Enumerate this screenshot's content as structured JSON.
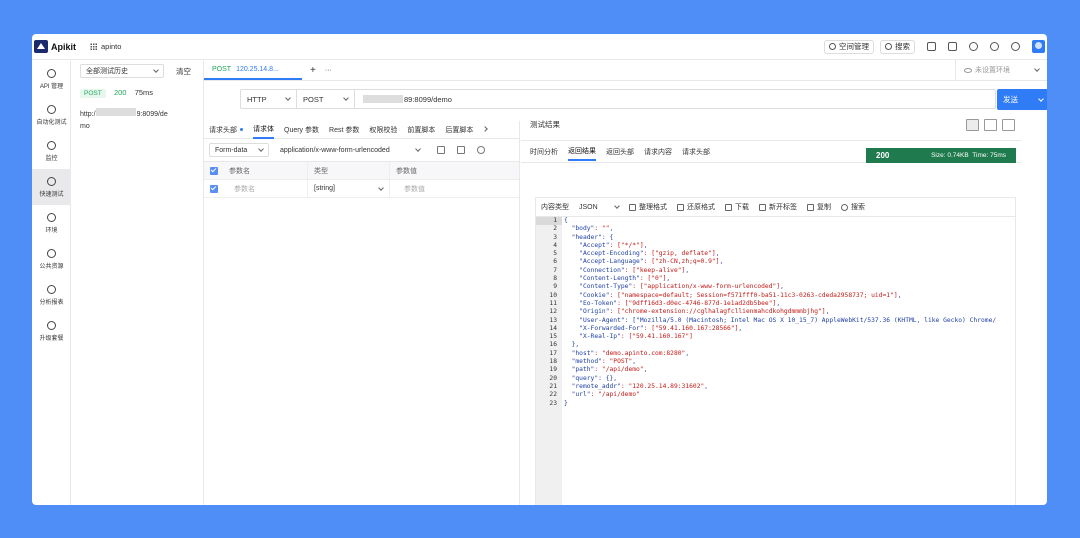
{
  "app": {
    "name": "Apikit",
    "workspace": "apinto"
  },
  "top_actions": {
    "space_manage": "空间管理",
    "search": "搜索"
  },
  "nav": [
    {
      "label": "API 管理",
      "icon": "api-icon"
    },
    {
      "label": "自动化测试",
      "icon": "robot-icon"
    },
    {
      "label": "监控",
      "icon": "monitor-icon"
    },
    {
      "label": "快速测试",
      "icon": "rocket-icon",
      "active": true
    },
    {
      "label": "环境",
      "icon": "environment-icon"
    },
    {
      "label": "公共资源",
      "icon": "share-icon"
    },
    {
      "label": "分析报表",
      "icon": "chart-icon"
    },
    {
      "label": "升级套餐",
      "icon": "upgrade-icon"
    }
  ],
  "history": {
    "filter": "全部测试历史",
    "clear": "清空",
    "item": {
      "method": "POST",
      "status": "200",
      "time": "75ms",
      "url_prefix": "http:/",
      "url_suffix": "9:8099/de",
      "url_line2": "mo"
    }
  },
  "tab": {
    "method": "POST",
    "url": "120.25.14.8...",
    "add": "+",
    "more": "···",
    "env": "未设置环境"
  },
  "request": {
    "protocol": "HTTP",
    "method": "POST",
    "url_suffix": "89:8099/demo",
    "send": "发送"
  },
  "req_tabs": [
    "请求头部",
    "请求体",
    "Query 参数",
    "Rest 参数",
    "权限校验",
    "前置脚本",
    "后置脚本"
  ],
  "body": {
    "mode": "Form-data",
    "content_type": "application/x-www-form-urlencoded"
  },
  "params": {
    "head": {
      "name": "参数名",
      "type": "类型",
      "value": "参数值"
    },
    "row": {
      "name": "参数名",
      "type": "[string]",
      "value": "参数值"
    }
  },
  "result": {
    "title": "测试结果",
    "tabs": [
      "时间分析",
      "返回结果",
      "返回头部",
      "请求内容",
      "请求头部"
    ],
    "status_code": "200",
    "size": "Size: 0.74KB",
    "time": "Time: 75ms",
    "content_type_label": "内容类型",
    "format": "JSON",
    "actions": [
      "整理格式",
      "还原格式",
      "下载",
      "新开标签",
      "复制",
      "搜索"
    ]
  },
  "code_lines": [
    "{",
    "  \"body\": \"\",",
    "  \"header\": {",
    "    \"Accept\": [\"*/*\"],",
    "    \"Accept-Encoding\": [\"gzip, deflate\"],",
    "    \"Accept-Language\": [\"zh-CN,zh;q=0.9\"],",
    "    \"Connection\": [\"keep-alive\"],",
    "    \"Content-Length\": [\"0\"],",
    "    \"Content-Type\": [\"application/x-www-form-urlencoded\"],",
    "    \"Cookie\": [\"namespace=default; Session=f571fff0-ba51-11c3-0263-cdeda2958737; uid=1\"],",
    "    \"Eo-Token\": [\"9dff16d3-d0ec-4746-877d-1e1ad2db5bee\"],",
    "    \"Origin\": [\"chrome-extension://cglhalagfcllienmahcdkohgdmmmbjhg\"],",
    "    \"User-Agent\": [\"Mozilla/5.0 (Macintosh; Intel Mac OS X 10_15_7) AppleWebKit/537.36 (KHTML, like Gecko) Chrome/",
    "    \"X-Forwarded-For\": [\"59.41.160.167:28566\"],",
    "    \"X-Real-Ip\": [\"59.41.160.167\"]",
    "  },",
    "  \"host\": \"demo.apinto.com:8280\",",
    "  \"method\": \"POST\",",
    "  \"path\": \"/api/demo\",",
    "  \"query\": {},",
    "  \"remote_addr\": \"120.25.14.89:31602\",",
    "  \"url\": \"/api/demo\"",
    "}"
  ]
}
